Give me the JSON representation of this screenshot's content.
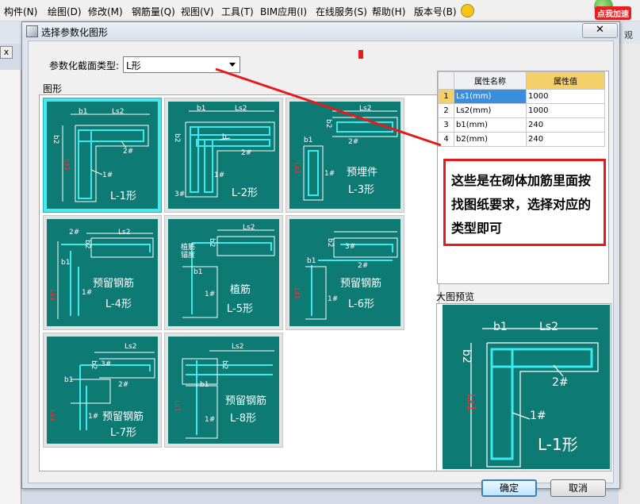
{
  "menu": [
    "构件(N)",
    "绘图(D)",
    "修改(M)",
    "钢筋量(Q)",
    "视图(V)",
    "工具(T)",
    "BIM应用(I)",
    "在线服务(S)",
    "帮助(H)",
    "版本号(B)"
  ],
  "speed_badge": "点我加速",
  "bg": {
    "view_text": "观察",
    "left_close": "x"
  },
  "dialog": {
    "title": "选择参数化图形",
    "close_glyph": "✕",
    "type_label": "参数化截面类型:",
    "type_value": "L形",
    "shapes_title": "图形",
    "preview_title": "大图预览",
    "ok": "确定",
    "cancel": "取消"
  },
  "properties": {
    "header_name": "属性名称",
    "header_value": "属性值",
    "rows": [
      {
        "n": "1",
        "name": "Ls1(mm)",
        "value": "1000"
      },
      {
        "n": "2",
        "name": "Ls2(mm)",
        "value": "1000"
      },
      {
        "n": "3",
        "name": "b1(mm)",
        "value": "240"
      },
      {
        "n": "4",
        "name": "b2(mm)",
        "value": "240"
      }
    ]
  },
  "annotation": "这些是在砌体加筋里面按找图纸要求，选择对应的类型即可",
  "shapes": [
    {
      "caption": "L-1形",
      "labels": [
        "b1",
        "Ls2",
        "b2",
        "2#",
        "1#",
        "Ls1"
      ]
    },
    {
      "caption": "L-2形",
      "labels": [
        "b1",
        "Ls2",
        "b2",
        "b",
        "2#",
        "1#",
        "3#"
      ]
    },
    {
      "caption": "预埋件",
      "caption2": "L-3形",
      "labels": [
        "Ls2",
        "b2",
        "b1",
        "2#",
        "1#",
        "Ls1"
      ]
    },
    {
      "caption": "预留钢筋",
      "caption2": "L-4形",
      "labels": [
        "2#",
        "Ls2",
        "b2",
        "b1",
        "1#",
        "Ls1"
      ]
    },
    {
      "caption": "植筋",
      "caption2": "L-5形",
      "labels": [
        "植筋",
        "锚度",
        "Ls2",
        "b2",
        "b1",
        "1#"
      ]
    },
    {
      "caption": "预留钢筋",
      "caption2": "L-6形",
      "labels": [
        "b2",
        "3#",
        "2#",
        "b1",
        "1#",
        "Ls1"
      ]
    },
    {
      "caption": "预留钢筋",
      "caption2": "L-7形",
      "labels": [
        "Ls2",
        "b2",
        "3#",
        "b1",
        "2#",
        "1#",
        "Ls1"
      ]
    },
    {
      "caption": "预留钢筋",
      "caption2": "L-8形",
      "labels": [
        "Ls2",
        "b2",
        "b1",
        "1#",
        "Ls1"
      ]
    }
  ],
  "preview": {
    "caption": "L-1形",
    "labels": [
      "b1",
      "Ls2",
      "b2",
      "2#",
      "1#",
      "Ls1"
    ]
  }
}
